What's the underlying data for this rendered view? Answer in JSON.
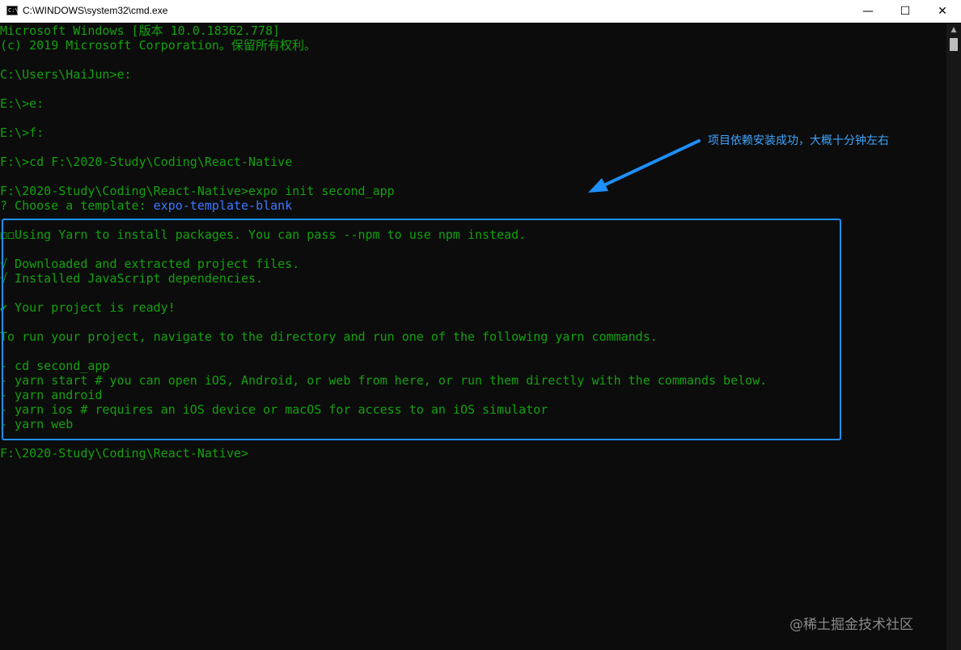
{
  "window": {
    "title": "C:\\WINDOWS\\system32\\cmd.exe",
    "icon": "cmd-icon",
    "controls": {
      "minimize": "—",
      "maximize": "☐",
      "close": "✕"
    }
  },
  "console": {
    "lines": [
      "Microsoft Windows [版本 10.0.18362.778]",
      "(c) 2019 Microsoft Corporation。保留所有权利。",
      "",
      "C:\\Users\\HaiJun>e:",
      "",
      "E:\\>e:",
      "",
      "E:\\>f:",
      "",
      "F:\\>cd F:\\2020-Study\\Coding\\React-Native",
      "",
      "F:\\2020-Study\\Coding\\React-Native>expo init second_app",
      "? Choose a template: ",
      "",
      "◻◻Using Yarn to install packages. You can pass --npm to use npm instead.",
      "",
      "√ Downloaded and extracted project files.",
      "√ Installed JavaScript dependencies.",
      "",
      "✔ Your project is ready!",
      "",
      "To run your project, navigate to the directory and run one of the following yarn commands.",
      "",
      "- cd second_app",
      "- yarn start # you can open iOS, Android, or web from here, or run them directly with the commands below.",
      "- yarn android",
      "- yarn ios # requires an iOS device or macOS for access to an iOS simulator",
      "- yarn web",
      "",
      "F:\\2020-Study\\Coding\\React-Native>"
    ],
    "template_choice": "expo-template-blank",
    "colors": {
      "text": "#13a10e",
      "highlight": "#3b78ff",
      "background": "#0c0c0c"
    }
  },
  "annotation": {
    "text": "项目依赖安装成功，大概十分钟左右",
    "color": "#3ea6ff"
  },
  "watermark": "@稀土掘金技术社区"
}
